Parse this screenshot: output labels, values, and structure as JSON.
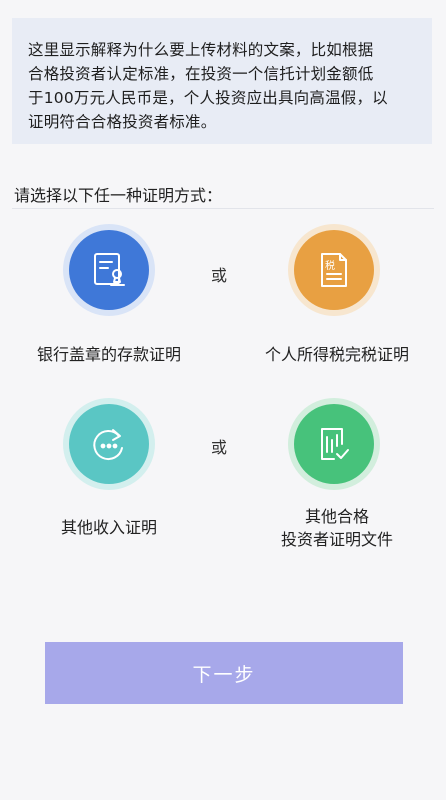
{
  "explanation": {
    "lines": [
      "这里显示解释为什么要上传材料的文案，比如根据",
      "合格投资者认定标准，在投资一个信托计划金额低",
      "于100万元人民币是，个人投资应出具向高温假，以",
      "证明符合合格投资者标准。"
    ]
  },
  "prompt": "请选择以下任一种证明方式：",
  "or_label": "或",
  "options": [
    {
      "lines": [
        "银行盖章的存款证明"
      ],
      "icon": "bank-stamp-document-icon",
      "color": "#3f78d8",
      "halo": "#d9e4f7"
    },
    {
      "lines": [
        "个人所得税完税证明"
      ],
      "icon": "tax-document-icon",
      "color": "#e8a042",
      "halo": "#f7e6cf",
      "icon_text": "税"
    },
    {
      "lines": [
        "其他收入证明"
      ],
      "icon": "income-refresh-icon",
      "color": "#5ac6c4",
      "halo": "#d3efee"
    },
    {
      "lines": [
        "其他合格",
        "投资者证明文件"
      ],
      "icon": "chart-check-document-icon",
      "color": "#47c27b",
      "halo": "#d2eedd"
    }
  ],
  "next_button": "下一步",
  "colors": {
    "button": "#a7a8ea",
    "explanation_bg": "#e8ecf5"
  }
}
